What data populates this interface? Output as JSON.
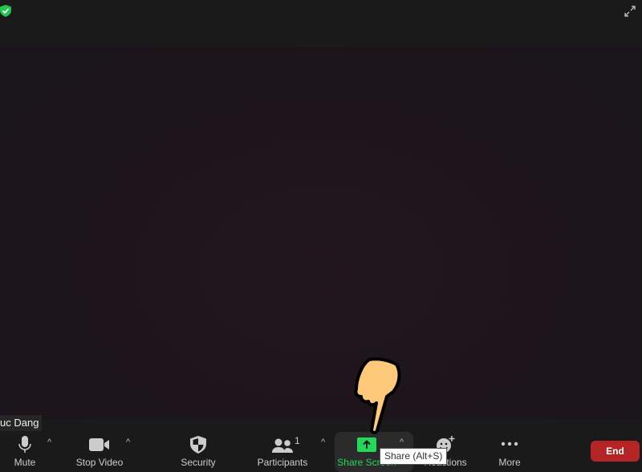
{
  "window": {
    "security_icon": "shield-check-icon",
    "fullscreen_icon": "expand-icon"
  },
  "participant": {
    "name": "uc Dang"
  },
  "toolbar": {
    "mute": "Mute",
    "stop_video": "Stop Video",
    "security": "Security",
    "participants": "Participants",
    "participants_count": "1",
    "share_screen": "Share Screen",
    "reactions": "Reactions",
    "more": "More",
    "end": "End"
  },
  "tooltip": "Share (Alt+S)",
  "colors": {
    "share_green": "#23d959",
    "end_red": "#b52525",
    "security_green": "#23c552"
  }
}
